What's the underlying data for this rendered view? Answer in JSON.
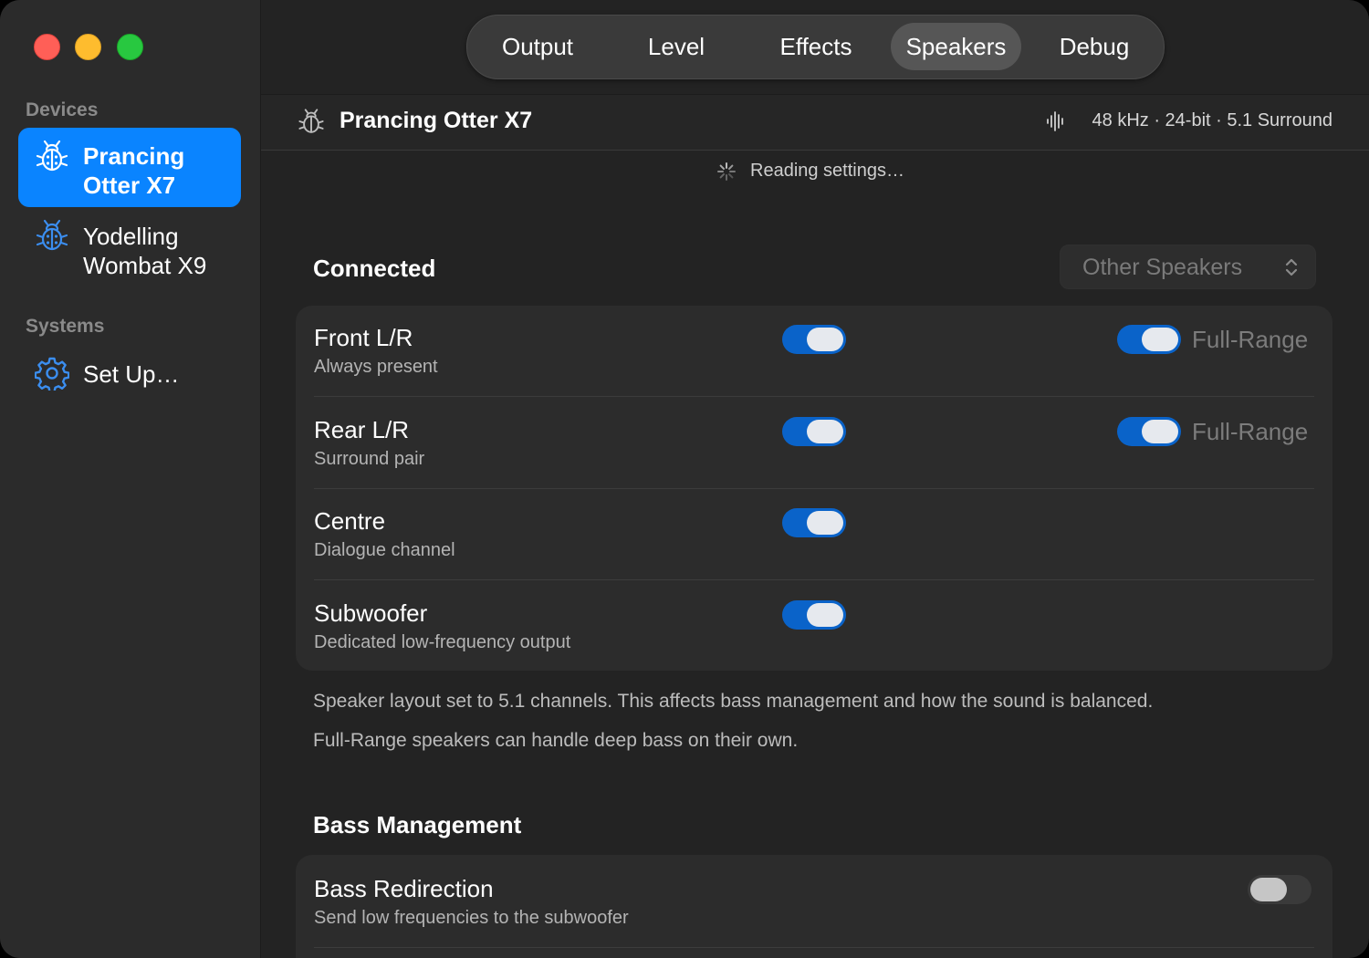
{
  "window": {
    "controls": [
      "close",
      "minimize",
      "zoom"
    ]
  },
  "tabs": [
    {
      "label": "Output",
      "active": false
    },
    {
      "label": "Level",
      "active": false
    },
    {
      "label": "Effects",
      "active": false
    },
    {
      "label": "Speakers",
      "active": true
    },
    {
      "label": "Debug",
      "active": false
    }
  ],
  "sidebar": {
    "devices_header": "Devices",
    "devices": [
      {
        "line1": "Prancing",
        "line2": "Otter X7",
        "icon": "bug-icon",
        "active": true
      },
      {
        "line1": "Yodelling",
        "line2": "Wombat X9",
        "icon": "bug-icon",
        "active": false
      }
    ],
    "systems_header": "Systems",
    "systems": [
      {
        "label": "Set Up…",
        "icon": "gear-icon"
      }
    ]
  },
  "header": {
    "device_name": "Prancing Otter X7",
    "format": "48 kHz · 24-bit · 5.1 Surround"
  },
  "status": {
    "text": "Reading settings…"
  },
  "connected": {
    "title": "Connected",
    "select_value": "Other Speakers",
    "speakers": [
      {
        "name": "Front L/R",
        "desc": "Always present",
        "enabled": true,
        "full_range": true,
        "full_range_label": "Full-Range"
      },
      {
        "name": "Rear L/R",
        "desc": "Surround pair",
        "enabled": true,
        "full_range": true,
        "full_range_label": "Full-Range"
      },
      {
        "name": "Centre",
        "desc": "Dialogue channel",
        "enabled": true
      },
      {
        "name": "Subwoofer",
        "desc": "Dedicated low-frequency output",
        "enabled": true
      }
    ],
    "notes": [
      "Speaker layout set to 5.1 channels. This affects bass management and how the sound is balanced.",
      "Full-Range speakers can handle deep bass on their own."
    ]
  },
  "bass": {
    "title": "Bass Management",
    "redirection": {
      "name": "Bass Redirection",
      "desc": "Send low frequencies to the subwoofer",
      "enabled": false
    }
  },
  "colors": {
    "accent": "#0a84ff",
    "toggle_on": "#0a63c9",
    "window_bg": "#232323",
    "sidebar_bg": "#2b2b2b"
  }
}
